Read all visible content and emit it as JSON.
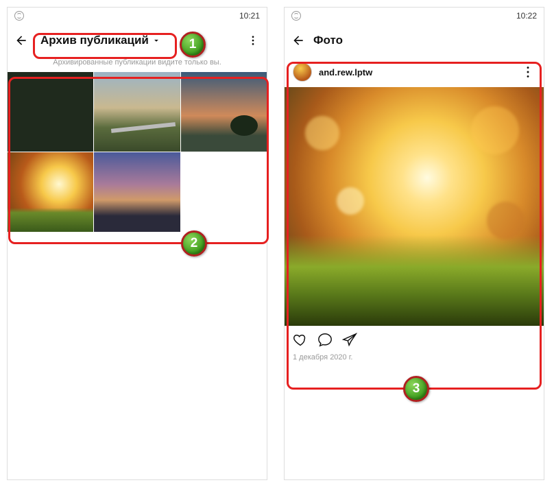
{
  "left": {
    "status_time": "10:21",
    "title": "Архив публикаций",
    "subtitle": "Архивированные публикации видите только вы."
  },
  "right": {
    "status_time": "10:22",
    "title": "Фото",
    "post": {
      "username": "and.rew.lptw",
      "date": "1 декабря 2020 г."
    }
  },
  "badges": {
    "one": "1",
    "two": "2",
    "three": "3"
  }
}
